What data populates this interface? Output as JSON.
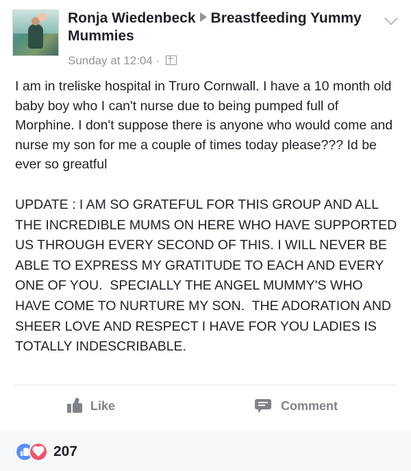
{
  "post": {
    "author": "Ronja Wiedenbeck",
    "group": "Breastfeeding Yummy Mummies",
    "timestamp": "Sunday at 12:04",
    "separator": "·",
    "privacy_icon": "public-icon",
    "menu_icon": "chevron-down-icon",
    "body": "I am in treliske hospital in Truro Cornwall. I have a 10 month old baby boy who I can't nurse due to being pumped full of Morphine. I don't suppose there is anyone who would come and nurse my son for me a couple of times today please??? Id be ever so greatful",
    "update": "UPDATE : I AM SO GRATEFUL FOR THIS GROUP AND ALL THE INCREDIBLE MUMS ON HERE WHO HAVE SUPPORTED US THROUGH EVERY SECOND OF THIS. I WILL NEVER BE ABLE TO EXPRESS MY GRATITUDE TO EACH AND EVERY ONE OF YOU.  SPECIALLY THE ANGEL MUMMY'S WHO HAVE COME TO NURTURE MY SON.  THE ADORATION AND SHEER LOVE AND RESPECT I HAVE FOR YOU LADIES IS TOTALLY INDESCRIBABLE."
  },
  "actions": {
    "like_label": "Like",
    "like_icon": "thumbs-up-icon",
    "comment_label": "Comment",
    "comment_icon": "comment-bubble-icon"
  },
  "reactions": {
    "icons": [
      "like-reaction-icon",
      "love-reaction-icon"
    ],
    "count": "207",
    "like_color": "#5890ff",
    "love_color": "#f25268"
  },
  "colors": {
    "text": "#1d2129",
    "muted": "#90949c",
    "action": "#7f8389"
  }
}
